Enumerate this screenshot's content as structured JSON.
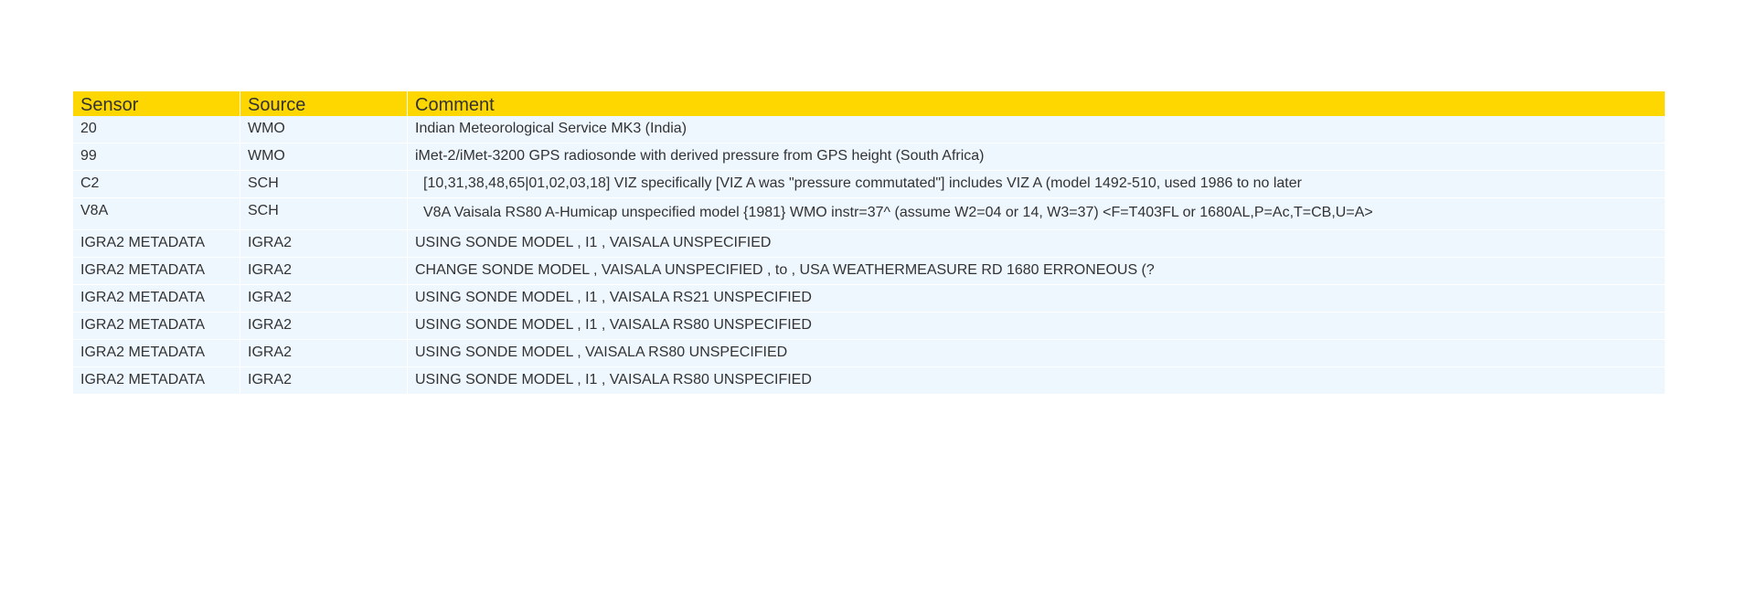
{
  "table": {
    "headers": [
      "Sensor",
      "Source",
      "Comment"
    ],
    "rows": [
      {
        "sensor": "20",
        "source": "WMO",
        "comment": "Indian Meteorological Service MK3 (India)"
      },
      {
        "sensor": "99",
        "source": "WMO",
        "comment": "iMet-2/iMet-3200 GPS radiosonde with derived pressure from GPS height (South Africa)"
      },
      {
        "sensor": "C2",
        "source": "SCH",
        "comment": "[10,31,38,48,65|01,02,03,18] VIZ specifically [VIZ A was \"pressure commutated\"] includes VIZ A (model 1492-510, used 1986 to no later"
      },
      {
        "sensor": "V8A",
        "source": "SCH",
        "comment": "V8A Vaisala RS80 A-Humicap unspecified model {1981} WMO instr=37^ (assume W2=04 or 14, W3=37) <F=T403FL or 1680AL,P=Ac,T=CB,U=A>"
      },
      {
        "sensor": "IGRA2 METADATA",
        "source": "IGRA2",
        "comment": "USING SONDE MODEL , I1 , VAISALA UNSPECIFIED"
      },
      {
        "sensor": "IGRA2 METADATA",
        "source": "IGRA2",
        "comment": "CHANGE SONDE MODEL , VAISALA UNSPECIFIED , to , USA WEATHERMEASURE RD 1680 ERRONEOUS (?"
      },
      {
        "sensor": "IGRA2 METADATA",
        "source": "IGRA2",
        "comment": "USING SONDE MODEL , I1 , VAISALA RS21 UNSPECIFIED"
      },
      {
        "sensor": "IGRA2 METADATA",
        "source": "IGRA2",
        "comment": "USING SONDE MODEL , I1 , VAISALA RS80 UNSPECIFIED"
      },
      {
        "sensor": "IGRA2 METADATA",
        "source": "IGRA2",
        "comment": "USING SONDE MODEL , VAISALA RS80 UNSPECIFIED"
      },
      {
        "sensor": "IGRA2 METADATA",
        "source": "IGRA2",
        "comment": "USING SONDE MODEL , I1 , VAISALA RS80 UNSPECIFIED"
      }
    ]
  },
  "colors": {
    "header_background": "#ffd700",
    "row_background": "#eef6fe",
    "text": "#333333"
  }
}
